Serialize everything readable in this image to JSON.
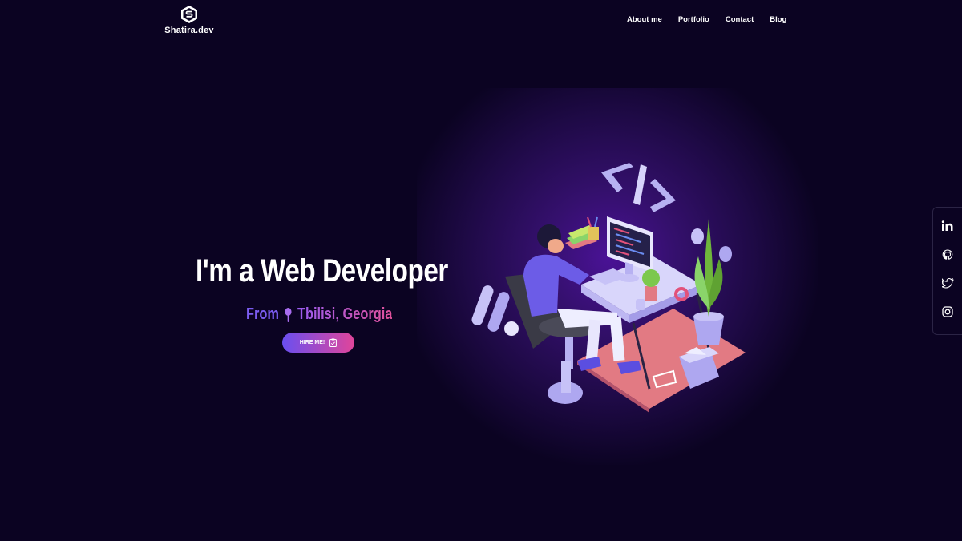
{
  "header": {
    "logo_text": "Shatira.dev",
    "logo_icon": "shield-s-icon",
    "nav": [
      {
        "label": "About me"
      },
      {
        "label": "Portfolio"
      },
      {
        "label": "Contact"
      },
      {
        "label": "Blog"
      }
    ]
  },
  "hero": {
    "title": "I'm a Web Developer",
    "from_label": "From",
    "location": "Tbilisi, Georgia",
    "location_icon": "map-pin-icon",
    "cta_label": "HIRE ME!",
    "cta_icon": "clipboard-check-icon"
  },
  "illustration": {
    "code_symbol": "</>"
  },
  "social": [
    {
      "icon": "linkedin-icon"
    },
    {
      "icon": "github-icon"
    },
    {
      "icon": "twitter-icon"
    },
    {
      "icon": "instagram-icon"
    }
  ],
  "colors": {
    "background": "#0b0322",
    "accent_purple": "#7b5cf0",
    "accent_pink": "#e0459a"
  }
}
